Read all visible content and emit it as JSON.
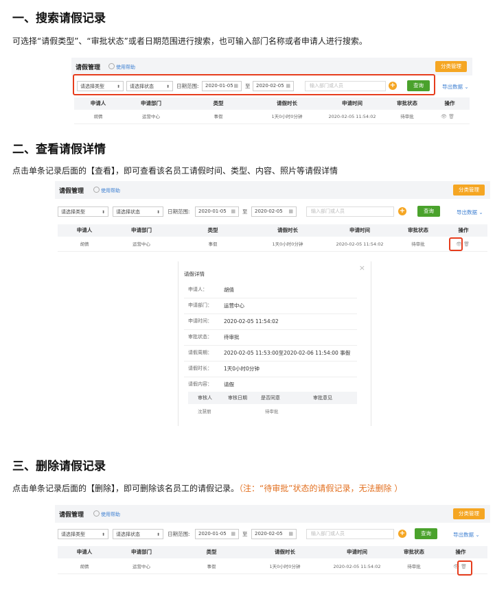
{
  "sec1": {
    "heading": "一、搜索请假记录",
    "desc": "可选择“请假类型”、“审批状态”或者日期范围进行搜索，也可输入部门名称或者申请人进行搜索。"
  },
  "sec2": {
    "heading": "二、查看请假详情",
    "desc": "点击单条记录后面的【查看】，即可查看该名员工请假时间、类型、内容、照片等请假详情"
  },
  "sec3": {
    "heading": "三、删除请假记录",
    "desc": "点击单条记录后面的【删除】，即可删除该名员工的请假记录。",
    "note": "（注：“待审批”状态的请假记录，无法删除 ）"
  },
  "ui": {
    "title": "请假管理",
    "help": "使用帮助",
    "category_btn": "分类管理",
    "type_select": "请选择类型",
    "status_select": "请选择状态",
    "date_label": "日期范围:",
    "date_from": "2020-01-05",
    "to": "至",
    "date_to": "2020-02-05",
    "search_placeholder": "输入部门或人员",
    "query_btn": "查询",
    "export": "导出数据",
    "columns": [
      "申请人",
      "申请部门",
      "类型",
      "请假时长",
      "申请时间",
      "审批状态",
      "操作"
    ],
    "row": [
      "胡倩",
      "运营中心",
      "事假",
      "1天0小时0分钟",
      "2020-02-05 11:54:02",
      "待审批"
    ]
  },
  "detail": {
    "title": "请假详情",
    "fields": [
      {
        "k": "申请人：",
        "v": "胡倩"
      },
      {
        "k": "申请部门：",
        "v": "运营中心"
      },
      {
        "k": "申请时间：",
        "v": "2020-02-05 11:54:02"
      },
      {
        "k": "审批状态：",
        "v": "待审批"
      },
      {
        "k": "请假周期：",
        "v": "2020-02-05 11:53:00至2020-02-06 11:54:00 事假"
      },
      {
        "k": "请假时长：",
        "v": "1天0小时0分钟"
      },
      {
        "k": "请假内容：",
        "v": "请假"
      }
    ],
    "sub_columns": [
      "审核人",
      "审核日期",
      "是否同意",
      "审批意见"
    ],
    "sub_row": {
      "reviewer": "沈慧丽",
      "result": "待审批"
    }
  },
  "icons": {
    "view": "eye-icon",
    "delete": "trash-icon",
    "add": "plus-circle-icon",
    "calendar": "calendar-icon"
  },
  "colors": {
    "highlight": "#e63c1c",
    "accent": "#f5a623",
    "query": "#4aa22c",
    "link": "#3d7fd1",
    "note": "#e26f1f"
  }
}
